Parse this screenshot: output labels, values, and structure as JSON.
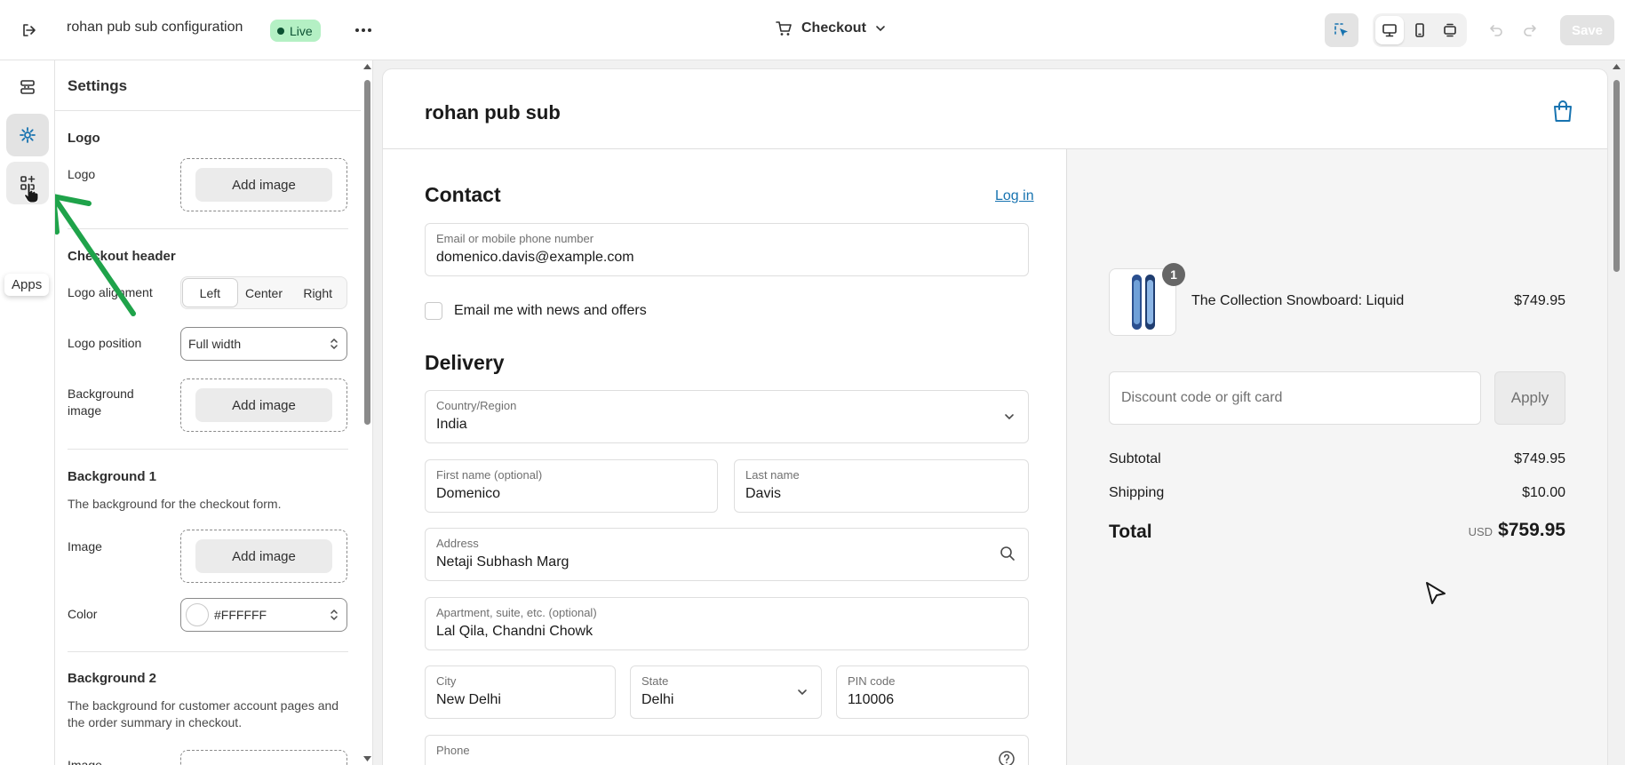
{
  "topbar": {
    "title": "rohan pub sub configuration",
    "status": "Live",
    "page_selector": "Checkout",
    "save_label": "Save"
  },
  "rail": {
    "tooltip": "Apps"
  },
  "settings": {
    "title": "Settings",
    "logo_section": "Logo",
    "logo_label": "Logo",
    "add_image": "Add image",
    "checkout_header": "Checkout header",
    "logo_alignment_label": "Logo alignment",
    "alignment_options": [
      "Left",
      "Center",
      "Right"
    ],
    "alignment_selected": "Left",
    "logo_position_label": "Logo position",
    "logo_position_value": "Full width",
    "background_image_label": "Background image",
    "background1_title": "Background 1",
    "background1_desc": "The background for the checkout form.",
    "image_label": "Image",
    "color_label": "Color",
    "color_value": "#FFFFFF",
    "background2_title": "Background 2",
    "background2_desc": "The background for customer account pages and the order summary in checkout.",
    "image_label_2": "Image"
  },
  "preview": {
    "shop_name": "rohan pub sub",
    "contact_heading": "Contact",
    "login_link": "Log in",
    "email_label": "Email or mobile phone number",
    "email_value": "domenico.davis@example.com",
    "newsletter_label": "Email me with news and offers",
    "delivery_heading": "Delivery",
    "country_label": "Country/Region",
    "country_value": "India",
    "first_name_label": "First name (optional)",
    "first_name_value": "Domenico",
    "last_name_label": "Last name",
    "last_name_value": "Davis",
    "address_label": "Address",
    "address_value": "Netaji Subhash Marg",
    "apartment_label": "Apartment, suite, etc. (optional)",
    "apartment_value": "Lal Qila, Chandni Chowk",
    "city_label": "City",
    "city_value": "New Delhi",
    "state_label": "State",
    "state_value": "Delhi",
    "pin_label": "PIN code",
    "pin_value": "110006",
    "phone_label": "Phone",
    "product_qty": "1",
    "product_name": "The Collection Snowboard: Liquid",
    "product_price": "$749.95",
    "discount_placeholder": "Discount code or gift card",
    "apply_label": "Apply",
    "subtotal_label": "Subtotal",
    "subtotal_value": "$749.95",
    "shipping_label": "Shipping",
    "shipping_value": "$10.00",
    "total_label": "Total",
    "total_currency": "USD",
    "total_value": "$759.95"
  },
  "colors": {
    "accent_link": "#1773b0",
    "live_badge_bg": "#b4f0c4",
    "annotation_arrow": "#1fa34a"
  }
}
